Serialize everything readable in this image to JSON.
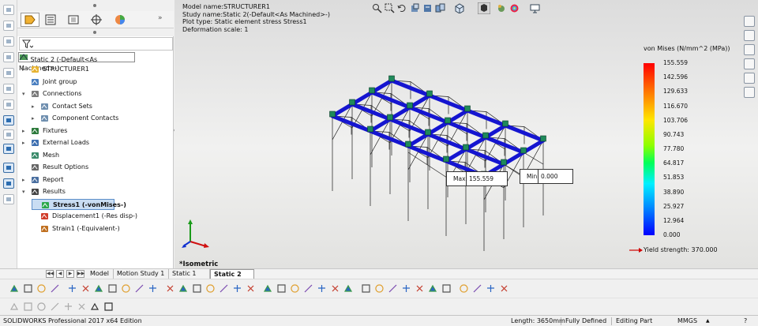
{
  "app": {
    "title": "SOLIDWORKS Professional 2017 x64 Edition"
  },
  "model_info": {
    "line1": "Model name:STRUCTURER1",
    "line2": "Study name:Static 2(-Default<As Machined>-)",
    "line3": "Plot type: Static element stress Stress1",
    "line4": "Deformation scale: 1"
  },
  "tree": {
    "root": "Static 2 (-Default<As Machined>-)",
    "items": [
      {
        "label": "STRUCTURER1",
        "icon": "part-icon",
        "arrow": "▸"
      },
      {
        "label": "Joint group",
        "icon": "joint-group-icon",
        "arrow": ""
      },
      {
        "label": "Connections",
        "icon": "connections-icon",
        "arrow": "▾"
      },
      {
        "label": "Contact Sets",
        "icon": "contact-sets-icon",
        "arrow": "▸"
      },
      {
        "label": "Component Contacts",
        "icon": "component-contacts-icon",
        "arrow": "▸"
      },
      {
        "label": "Fixtures",
        "icon": "fixtures-icon",
        "arrow": "▸"
      },
      {
        "label": "External Loads",
        "icon": "external-loads-icon",
        "arrow": "▸"
      },
      {
        "label": "Mesh",
        "icon": "mesh-icon",
        "arrow": ""
      },
      {
        "label": "Result Options",
        "icon": "result-options-icon",
        "arrow": ""
      },
      {
        "label": "Report",
        "icon": "report-icon",
        "arrow": "▸"
      },
      {
        "label": "Results",
        "icon": "results-folder-icon",
        "arrow": "▾"
      },
      {
        "label": "Stress1 (-vonMises-)",
        "icon": "stress-plot-icon",
        "arrow": "",
        "selected": true
      },
      {
        "label": "Displacement1 (-Res disp-)",
        "icon": "displacement-plot-icon",
        "arrow": ""
      },
      {
        "label": "Strain1 (-Equivalent-)",
        "icon": "strain-plot-icon",
        "arrow": ""
      }
    ]
  },
  "legend": {
    "title": "von Mises (N/mm^2 (MPa))",
    "values": [
      "155.559",
      "142.596",
      "129.633",
      "116.670",
      "103.706",
      "90.743",
      "77.780",
      "64.817",
      "51.853",
      "38.890",
      "25.927",
      "12.964",
      "0.000"
    ],
    "yield_strength": "Yield strength: 370.000"
  },
  "probes": {
    "max": {
      "label": "Max:",
      "value": "155.559"
    },
    "min": {
      "label": "Min:",
      "value": "0.000"
    }
  },
  "view": {
    "orientation": "*Isometric"
  },
  "bottom_tabs": [
    {
      "label": "Model",
      "active": false
    },
    {
      "label": "Motion Study 1",
      "active": false
    },
    {
      "label": "Static 1",
      "active": false
    },
    {
      "label": "Static 2",
      "active": true
    }
  ],
  "status": {
    "length": "Length: 3650mm",
    "definition": "Fully Defined",
    "mode": "Editing Part",
    "units": "MMGS"
  },
  "colors": {
    "beam": "#1515d0",
    "connector": "#1f8a5a",
    "accent": "#2b6cb0"
  }
}
